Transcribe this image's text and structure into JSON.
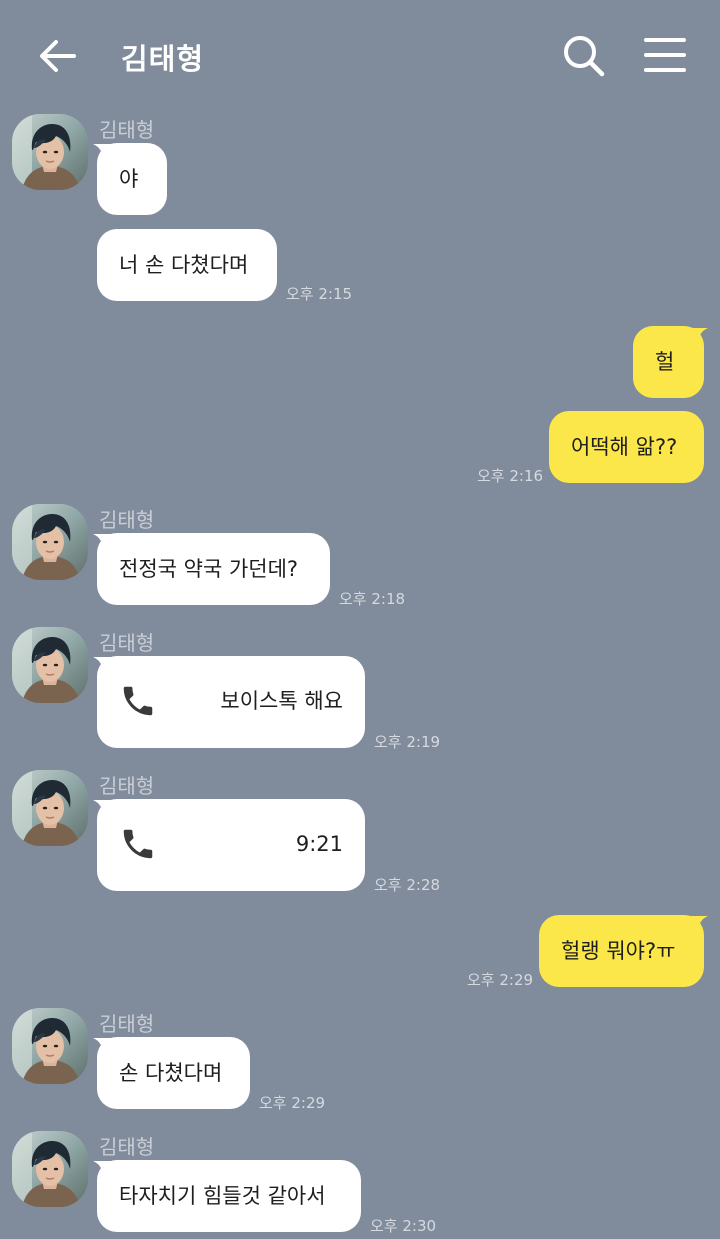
{
  "header": {
    "title": "김태형",
    "back_icon": "arrow-left-icon",
    "search_icon": "search-icon",
    "menu_icon": "hamburger-menu-icon"
  },
  "colors": {
    "background": "#808b9b",
    "incoming_bubble": "#ffffff",
    "outgoing_bubble": "#fbe74a"
  },
  "messages": [
    {
      "from": "김태형",
      "text": "야"
    },
    {
      "from": "김태형",
      "text": "너 손 다쳤다며",
      "time": "오후 2:15"
    },
    {
      "from": "me",
      "text": "헐"
    },
    {
      "from": "me",
      "text": "어떡해 앎??",
      "time": "오후 2:16"
    },
    {
      "from": "김태형",
      "text": "전정국 약국 가던데?",
      "time": "오후 2:18"
    },
    {
      "from": "김태형",
      "type": "call",
      "icon": "phone-icon",
      "text": "보이스톡 해요",
      "time": "오후 2:19"
    },
    {
      "from": "김태형",
      "type": "call",
      "icon": "phone-icon",
      "text": "9:21",
      "time": "오후 2:28"
    },
    {
      "from": "me",
      "text": "헐랭 뭐야?ㅠ",
      "time": "오후 2:29"
    },
    {
      "from": "김태형",
      "text": "손 다쳤다며",
      "time": "오후 2:29"
    },
    {
      "from": "김태형",
      "text": "타자치기 힘들것 같아서",
      "time": "오후 2:30"
    }
  ]
}
